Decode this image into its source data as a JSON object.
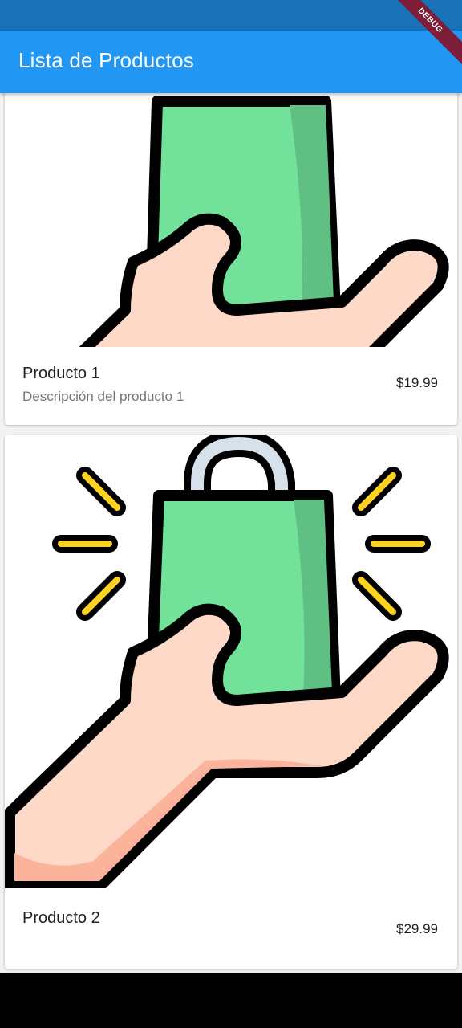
{
  "app_bar": {
    "title": "Lista de Productos"
  },
  "debug_banner": {
    "label": "DEBUG"
  },
  "products": [
    {
      "name": "Producto 1",
      "description": "Descripción del producto 1",
      "price": "$19.99",
      "image_icon": "hand-receiving-shopping-bag-icon"
    },
    {
      "name": "Producto 2",
      "description": "",
      "price": "$29.99",
      "image_icon": "hand-receiving-shopping-bag-icon"
    }
  ],
  "colors": {
    "app_bar": "#2196f3",
    "status_bar": "#1a72b8",
    "debug_ribbon": "#7d1d37",
    "bag_green": "#72e29a",
    "bag_green_dark": "#60c084",
    "skin": "#ffd9c8",
    "skin_dark": "#fcb39c",
    "handle": "#d6e1ec",
    "spark": "#ffd21f"
  }
}
